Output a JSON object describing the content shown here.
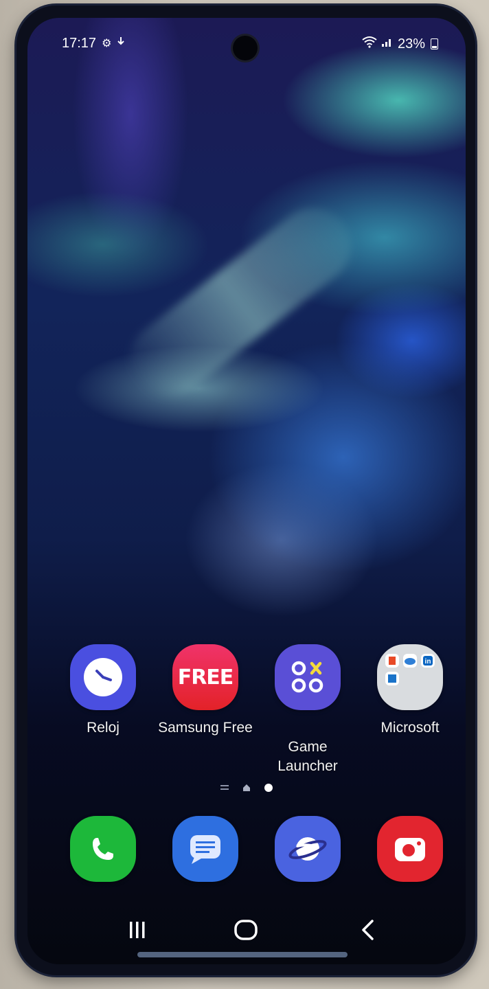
{
  "status_bar": {
    "time": "17:17",
    "left_icons": [
      "gear-icon",
      "download-icon"
    ],
    "right_icons": [
      "wifi-icon",
      "signal-icon"
    ],
    "battery_text": "23%"
  },
  "apps": [
    {
      "label": "Reloj",
      "icon": "clock-icon",
      "color": "#4a4fe0"
    },
    {
      "label": "Samsung Free",
      "icon": "free-icon",
      "icon_text": "FREE",
      "color": "#ea2a3a"
    },
    {
      "label": "Game\nLauncher",
      "icon": "game-launcher-icon",
      "color": "#5a4fd6"
    },
    {
      "label": "Microsoft",
      "icon": "folder-icon",
      "color": "#d9dcdf"
    }
  ],
  "page_indicator": {
    "pages": [
      "menu",
      "home",
      "current"
    ]
  },
  "dock": [
    {
      "name": "phone",
      "icon": "phone-icon",
      "color": "#1db83a"
    },
    {
      "name": "messages",
      "icon": "messages-icon",
      "color": "#2e6fe0"
    },
    {
      "name": "internet",
      "icon": "internet-icon",
      "color": "#4a63e0"
    },
    {
      "name": "camera",
      "icon": "camera-icon",
      "color": "#e2252f"
    }
  ],
  "nav_bar": {
    "buttons": [
      "recents-icon",
      "home-icon",
      "back-icon"
    ]
  }
}
